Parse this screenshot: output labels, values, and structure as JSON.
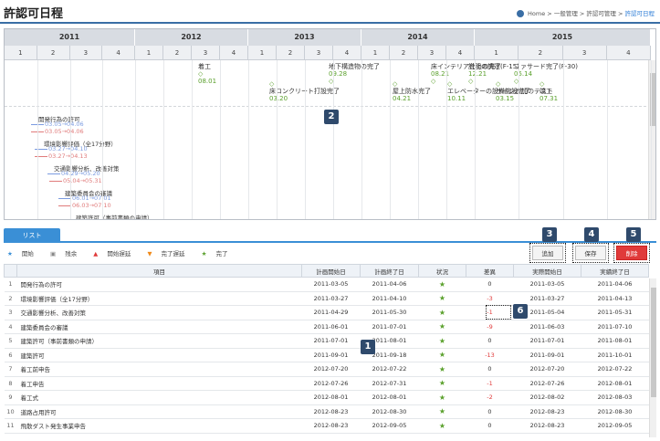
{
  "header": {
    "title": "許認可日程",
    "title_icon": "⇗",
    "breadcrumb": [
      "Home",
      "一般管理",
      "許認可管理",
      "許認可日程"
    ]
  },
  "gantt": {
    "years": [
      "2011",
      "2012",
      "2013",
      "2014",
      "2015"
    ],
    "quarters": [
      "1",
      "2",
      "3",
      "4",
      "1",
      "2",
      "3",
      "4",
      "1",
      "2",
      "3",
      "4",
      "1",
      "2",
      "3",
      "4",
      "1",
      "2",
      "3",
      "4"
    ],
    "milestones": [
      {
        "label": "着工",
        "date": "08.01"
      },
      {
        "label": "地下構造物の完了",
        "date": "09.28"
      },
      {
        "label": "床コンクリート打設完了",
        "date": "03.20"
      },
      {
        "label": "屋上防水完了",
        "date": "04.21"
      },
      {
        "label": "床インテリア仕上の完了",
        "date": "08.21"
      },
      {
        "label": "エレベーターの設備施設完了",
        "date": "10.11"
      },
      {
        "label": "説明の調達(F-15)",
        "date": "12.21"
      },
      {
        "label": "ファサード完了(F-30)",
        "date": "05.14"
      },
      {
        "label": "サイン追加のテスト",
        "date": "03.15"
      },
      {
        "label": "竣工",
        "date": "07.31"
      }
    ],
    "tasks": [
      {
        "name": "開発行為の許可",
        "plan": "03.05→04.06",
        "actual": "03.05→04.06"
      },
      {
        "name": "環境影響評価（全17分野）",
        "plan": "03.27→04.10",
        "actual": "03.27→04.13"
      },
      {
        "name": "交通影響分析、改善対策",
        "plan": "04.29→05.20",
        "actual": "05.04→05.31"
      },
      {
        "name": "建築委員会の審議",
        "plan": "06.01→07.01",
        "actual": "06.03→07.10"
      },
      {
        "name": "建築許可（事前書類の申請）",
        "plan": "",
        "actual": ""
      }
    ]
  },
  "tabs": {
    "list": "リスト"
  },
  "legend": [
    {
      "icon": "★",
      "label": "開始"
    },
    {
      "icon": "▣",
      "label": "残余"
    },
    {
      "icon": "▲",
      "label": "開始遅延"
    },
    {
      "icon": "▼",
      "label": "完了遅延"
    },
    {
      "icon": "★",
      "label": "完了"
    }
  ],
  "toolbar": {
    "add": "追加",
    "save": "保存",
    "delete": "削除"
  },
  "badges": [
    "1",
    "2",
    "3",
    "4",
    "5",
    "6"
  ],
  "colors": {
    "accent": "#3a8fd6",
    "delete": "#e03a3a",
    "done": "#5aa02c",
    "negative": "#e03a3a"
  },
  "table": {
    "headers": [
      "",
      "項目",
      "計画開始日",
      "計画終了日",
      "状況",
      "差異",
      "実際開始日",
      "実績終了日"
    ],
    "rows": [
      {
        "no": "1",
        "item": "開発行為の許可",
        "ps": "2011-03-05",
        "pe": "2011-04-06",
        "status": "★",
        "diff": "0",
        "as": "2011-03-05",
        "ae": "2011-04-06"
      },
      {
        "no": "2",
        "item": "環境影響評価（全17分野）",
        "ps": "2011-03-27",
        "pe": "2011-04-10",
        "status": "★",
        "diff": "-3",
        "as": "2011-03-27",
        "ae": "2011-04-13"
      },
      {
        "no": "3",
        "item": "交通影響分析、改善対策",
        "ps": "2011-04-29",
        "pe": "2011-05-30",
        "status": "★",
        "diff": "-1",
        "as": "2011-05-04",
        "ae": "2011-05-31"
      },
      {
        "no": "4",
        "item": "建築委員会の審議",
        "ps": "2011-06-01",
        "pe": "2011-07-01",
        "status": "★",
        "diff": "-9",
        "as": "2011-06-03",
        "ae": "2011-07-10"
      },
      {
        "no": "5",
        "item": "建築許可（事前書類の申請）",
        "ps": "2011-07-01",
        "pe": "2011-08-01",
        "status": "★",
        "diff": "0",
        "as": "2011-07-01",
        "ae": "2011-08-01"
      },
      {
        "no": "6",
        "item": "建築許可",
        "ps": "2011-09-01",
        "pe": "2011-09-18",
        "status": "★",
        "diff": "-13",
        "as": "2011-09-01",
        "ae": "2011-10-01"
      },
      {
        "no": "7",
        "item": "着工前申告",
        "ps": "2012-07-20",
        "pe": "2012-07-22",
        "status": "★",
        "diff": "0",
        "as": "2012-07-20",
        "ae": "2012-07-22"
      },
      {
        "no": "8",
        "item": "着工申告",
        "ps": "2012-07-26",
        "pe": "2012-07-31",
        "status": "★",
        "diff": "-1",
        "as": "2012-07-26",
        "ae": "2012-08-01"
      },
      {
        "no": "9",
        "item": "着工式",
        "ps": "2012-08-01",
        "pe": "2012-08-01",
        "status": "★",
        "diff": "-2",
        "as": "2012-08-02",
        "ae": "2012-08-03"
      },
      {
        "no": "10",
        "item": "道路占用許可",
        "ps": "2012-08-23",
        "pe": "2012-08-30",
        "status": "★",
        "diff": "0",
        "as": "2012-08-23",
        "ae": "2012-08-30"
      },
      {
        "no": "11",
        "item": "飛散ダスト発生事業申告",
        "ps": "2012-08-23",
        "pe": "2012-09-05",
        "status": "★",
        "diff": "0",
        "as": "2012-08-23",
        "ae": "2012-09-05"
      }
    ]
  }
}
